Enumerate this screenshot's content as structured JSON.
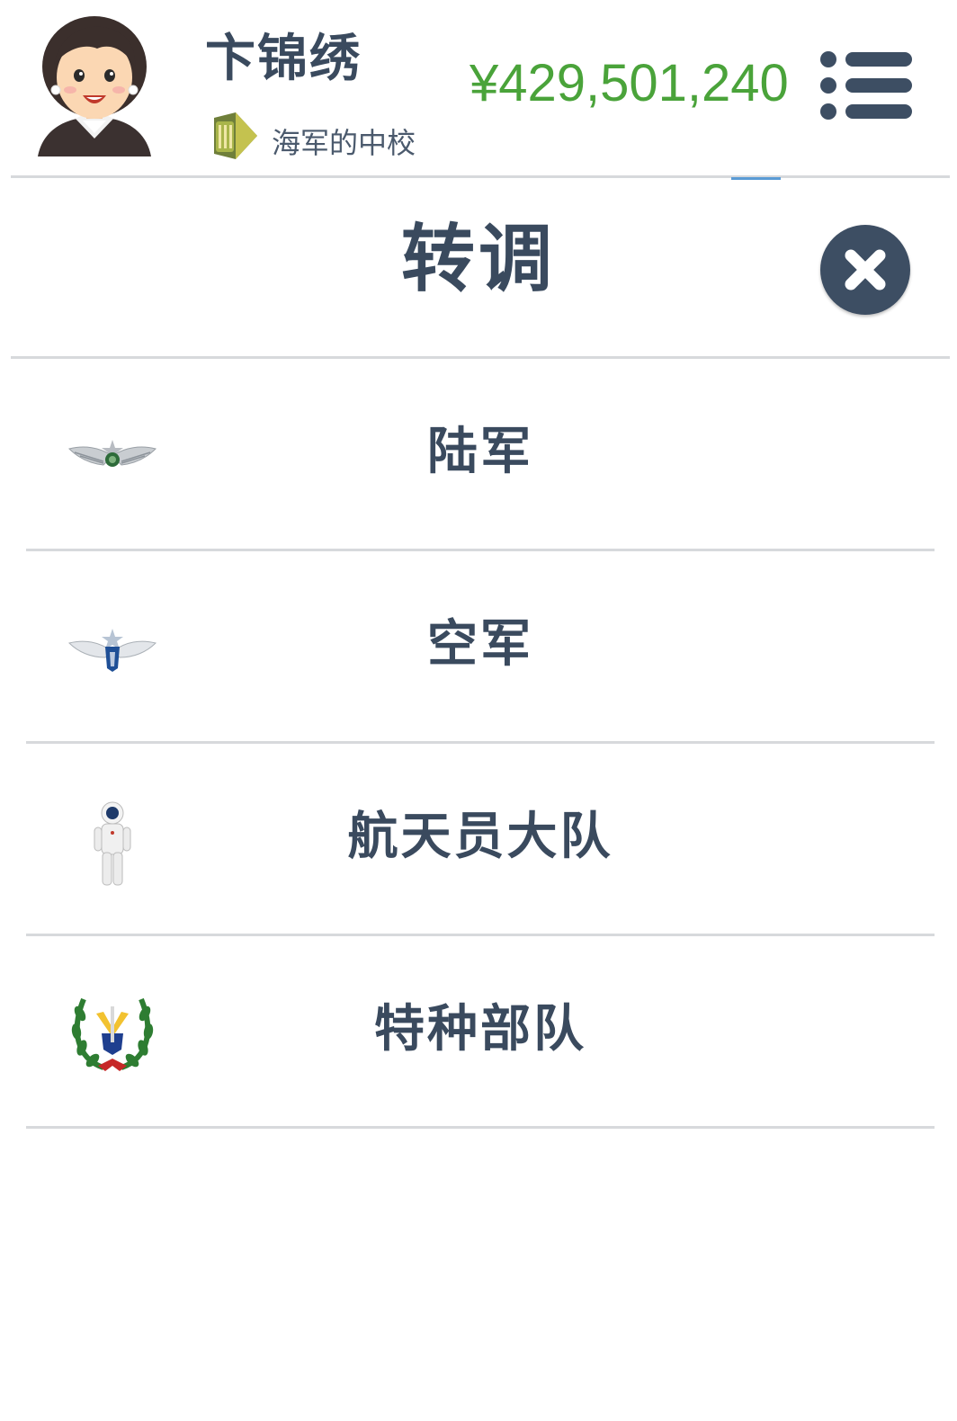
{
  "header": {
    "name": "卞锦绣",
    "rank": "海军的中校",
    "money": "¥429,501,240"
  },
  "dialog": {
    "title": "转调",
    "options": [
      {
        "label": "陆军",
        "icon": "army-wings-icon"
      },
      {
        "label": "空军",
        "icon": "airforce-wings-icon"
      },
      {
        "label": "航天员大队",
        "icon": "astronaut-icon"
      },
      {
        "label": "特种部队",
        "icon": "special-forces-emblem-icon"
      }
    ]
  },
  "colors": {
    "text": "#3a4a5e",
    "money": "#4aa33a",
    "close_bg": "#3d4e63",
    "divider": "#d7d9dc",
    "accent": "#5a9bd5"
  }
}
